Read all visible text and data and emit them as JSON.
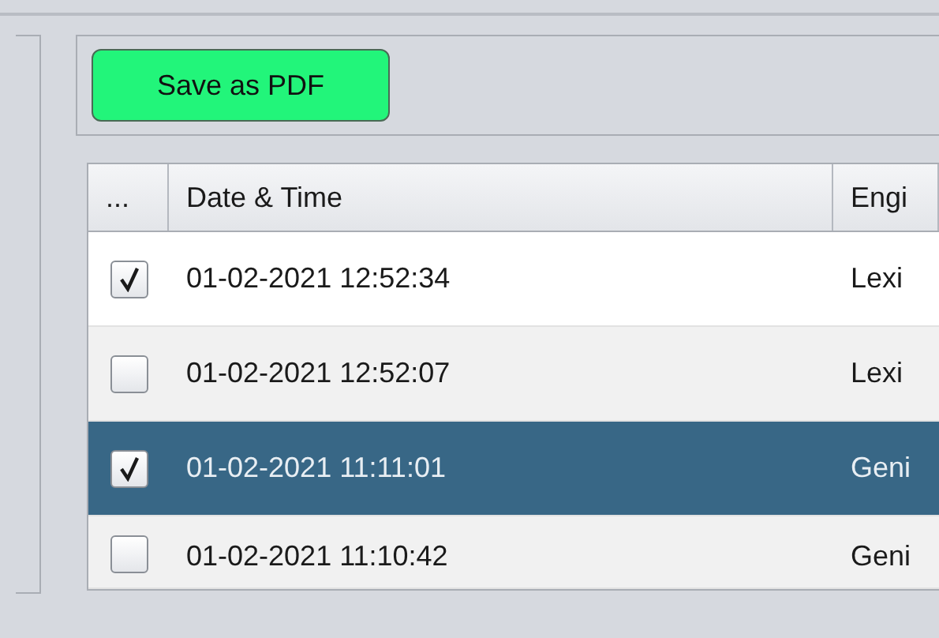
{
  "toolbar": {
    "save_button": "Save as PDF"
  },
  "table": {
    "columns": [
      "...",
      "Date & Time",
      "Engi"
    ],
    "rows": [
      {
        "checked": true,
        "selected": false,
        "date_time": "01-02-2021 12:52:34",
        "engine": "Lexi"
      },
      {
        "checked": false,
        "selected": false,
        "date_time": "01-02-2021 12:52:07",
        "engine": "Lexi"
      },
      {
        "checked": true,
        "selected": true,
        "date_time": "01-02-2021 11:11:01",
        "engine": "Geni"
      },
      {
        "checked": false,
        "selected": false,
        "date_time": "01-02-2021 11:10:42",
        "engine": "Geni"
      }
    ]
  }
}
